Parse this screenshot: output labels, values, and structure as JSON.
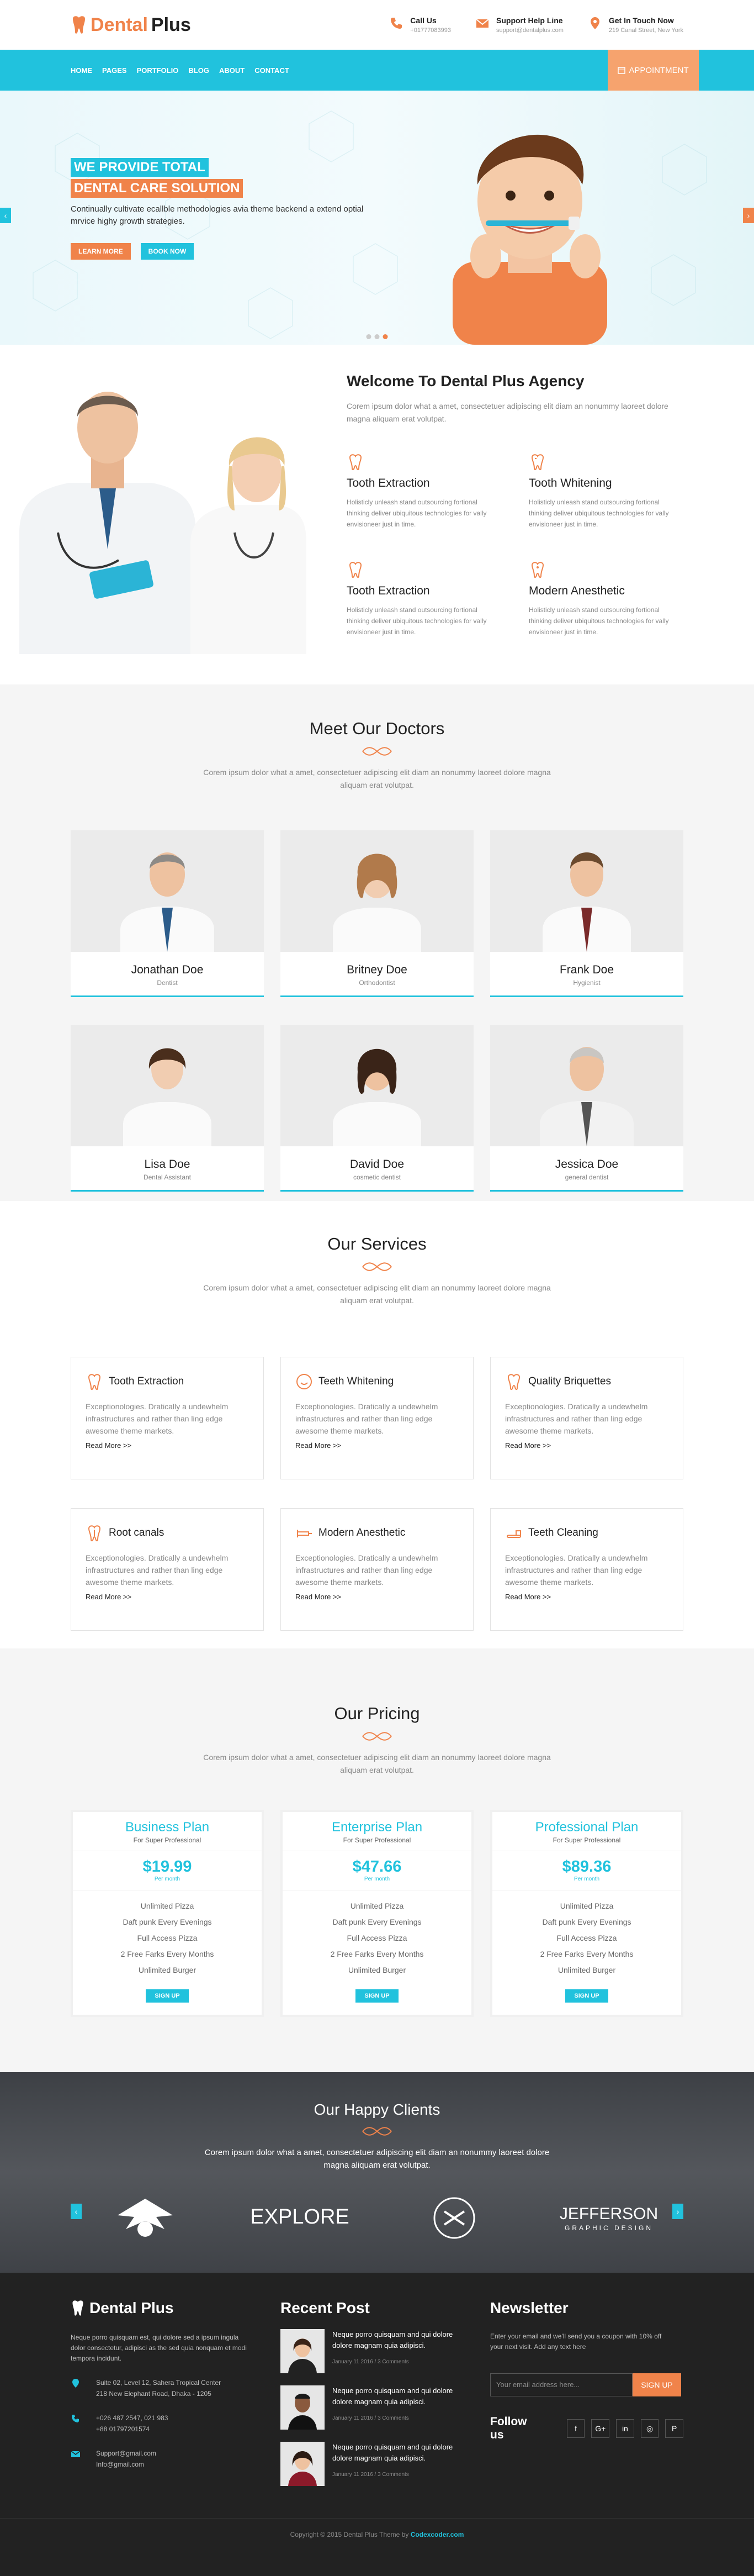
{
  "header": {
    "logo_part1": "Dental",
    "logo_part2": "Plus",
    "contacts": [
      {
        "title": "Call Us",
        "value": "+01777083993",
        "icon": "phone-icon"
      },
      {
        "title": "Support Help Line",
        "value": "support@dentalplus.com",
        "icon": "envelope-icon"
      },
      {
        "title": "Get In Touch Now",
        "value": "219 Canal Street, New York",
        "icon": "map-pin-icon"
      }
    ]
  },
  "nav": {
    "items": [
      "HOME",
      "PAGES",
      "PORTFOLIO",
      "BLOG",
      "ABOUT",
      "CONTACT"
    ],
    "appointment": "APPOINTMENT"
  },
  "hero": {
    "line1": "WE PROVIDE TOTAL",
    "line2": "DENTAL CARE SOLUTION",
    "text": "Continually cultivate ecallble methodologies avia theme backend a extend optial mrvice highy growth strategies.",
    "btn1": "LEARN MORE",
    "btn2": "BOOK NOW",
    "prev": "‹",
    "next": "›"
  },
  "welcome": {
    "title": "Welcome To Dental Plus Agency",
    "lead": "Corem ipsum dolor what a amet, consectetuer adipiscing elit diam an nonummy laoreet dolore magna aliquam erat volutpat.",
    "features": [
      {
        "title": "Tooth Extraction",
        "text": "Holisticly unleash stand outsourcing fortional thinking deliver ubiquitous technologies for vally envisioneer just in time."
      },
      {
        "title": "Tooth Whitening",
        "text": "Holisticly unleash stand outsourcing fortional thinking deliver ubiquitous technologies for vally envisioneer just in time."
      },
      {
        "title": "Tooth Extraction",
        "text": "Holisticly unleash stand outsourcing fortional thinking deliver ubiquitous technologies for vally envisioneer just in time."
      },
      {
        "title": "Modern Anesthetic",
        "text": "Holisticly unleash stand outsourcing fortional thinking deliver ubiquitous technologies for vally envisioneer just in time."
      }
    ]
  },
  "doctors": {
    "title": "Meet Our Doctors",
    "lead": "Corem ipsum dolor what a amet, consectetuer adipiscing elit diam an nonummy laoreet dolore magna aliquam erat volutpat.",
    "items": [
      {
        "name": "Jonathan Doe",
        "role": "Dentist"
      },
      {
        "name": "Britney Doe",
        "role": "Orthodontist"
      },
      {
        "name": "Frank Doe",
        "role": "Hygienist"
      },
      {
        "name": "Lisa Doe",
        "role": "Dental Assistant"
      },
      {
        "name": "David Doe",
        "role": "cosmetic dentist"
      },
      {
        "name": "Jessica Doe",
        "role": "general dentist"
      }
    ]
  },
  "services": {
    "title": "Our Services",
    "lead": "Corem ipsum dolor what a amet, consectetuer adipiscing elit diam an nonummy laoreet dolore magna aliquam erat volutpat.",
    "read_more": "Read More >>",
    "items": [
      {
        "title": "Tooth Extraction",
        "text": "Exceptionologies. Dratically a undewhelm infrastructures and rather than ling edge awesome theme markets."
      },
      {
        "title": "Teeth Whitening",
        "text": "Exceptionologies. Dratically a undewhelm infrastructures and rather than ling edge awesome theme markets."
      },
      {
        "title": "Quality Briquettes",
        "text": "Exceptionologies. Dratically a undewhelm infrastructures and rather than ling edge awesome theme markets."
      },
      {
        "title": "Root canals",
        "text": "Exceptionologies. Dratically a undewhelm infrastructures and rather than ling edge awesome theme markets."
      },
      {
        "title": "Modern Anesthetic",
        "text": "Exceptionologies. Dratically a undewhelm infrastructures and rather than ling edge awesome theme markets."
      },
      {
        "title": "Teeth Cleaning",
        "text": "Exceptionologies. Dratically a undewhelm infrastructures and rather than ling edge awesome theme markets."
      }
    ]
  },
  "pricing": {
    "title": "Our Pricing",
    "lead": "Corem ipsum dolor what a amet, consectetuer adipiscing elit diam an nonummy laoreet dolore magna aliquam erat volutpat.",
    "plans": [
      {
        "name": "Business Plan",
        "sub": "For Super Professional",
        "price": "$19.99",
        "per": "Per month",
        "features": [
          "Unlimited Pizza",
          "Daft punk Every Evenings",
          "Full Access Pizza",
          "2 Free Farks Every Months",
          "Unlimited Burger"
        ],
        "button": "SIGN UP"
      },
      {
        "name": "Enterprise Plan",
        "sub": "For Super Professional",
        "price": "$47.66",
        "per": "Per month",
        "features": [
          "Unlimited Pizza",
          "Daft punk Every Evenings",
          "Full Access Pizza",
          "2 Free Farks Every Months",
          "Unlimited Burger"
        ],
        "button": "SIGN UP"
      },
      {
        "name": "Professional Plan",
        "sub": "For Super Professional",
        "price": "$89.36",
        "per": "Per month",
        "features": [
          "Unlimited Pizza",
          "Daft punk Every Evenings",
          "Full Access Pizza",
          "2 Free Farks Every Months",
          "Unlimited Burger"
        ],
        "button": "SIGN UP"
      }
    ]
  },
  "clients": {
    "title": "Our Happy Clients",
    "lead": "Corem ipsum dolor what a amet, consectetuer adipiscing elit diam an nonummy laoreet dolore magna aliquam erat volutpat.",
    "logo2": "EXPLORE",
    "logo4a": "JEFFERSON",
    "logo4b": "GRAPHIC DESIGN"
  },
  "footer": {
    "logo": "Dental Plus",
    "about": "Neque porro quisquam est, qui dolore sed a ipsum ingula dolor consectetur, adipisci as the sed quia nonquam et modi tempora incidunt.",
    "address": [
      "Suite 02, Level 12, Sahera Tropical Center",
      "218 New Elephant Road, Dhaka - 1205"
    ],
    "phones": [
      "+026 487 2547, 021 983",
      "+88 01797201574"
    ],
    "emails": [
      "Support@gmail.com",
      "Info@gmail.com"
    ],
    "recent_title": "Recent Post",
    "posts": [
      {
        "title": "Neque porro quisquam and qui dolore dolore magnam quia adipisci.",
        "date": "January 11 2016 / 3 Comments"
      },
      {
        "title": "Neque porro quisquam and qui dolore dolore magnam quia adipisci.",
        "date": "January 11 2016 / 3 Comments"
      },
      {
        "title": "Neque porro quisquam and qui dolore dolore magnam quia adipisci.",
        "date": "January 11 2016 / 3 Comments"
      }
    ],
    "newsletter_title": "Newsletter",
    "newsletter_text": "Enter your email and we'll send you a coupon with 10% off your next visit. Add any text here",
    "email_placeholder": "Your email address here...",
    "signup": "SIGN UP",
    "follow": "Follow us",
    "social": [
      "f",
      "G+",
      "in",
      "◎",
      "P"
    ],
    "copyright": "Copyright © 2015 Dental Plus Theme by",
    "copyright_link": "Codexcoder.com"
  },
  "colors": {
    "accent": "#21c2dd",
    "orange": "#f0834a"
  }
}
